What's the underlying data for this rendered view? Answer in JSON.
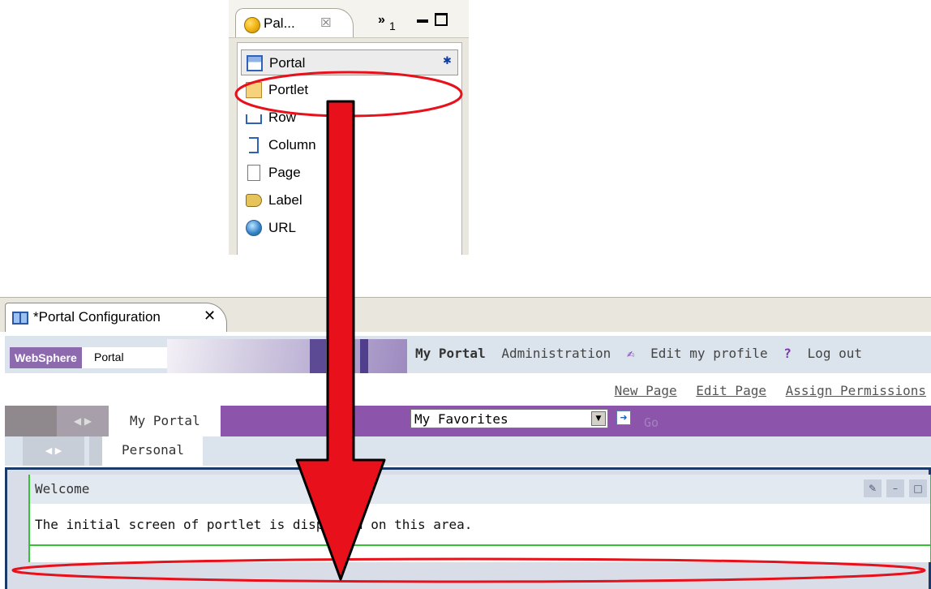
{
  "palette": {
    "tab_title": "Pal...",
    "tab_close": "☒",
    "overflow_count": "1",
    "items": [
      {
        "label": "Portal"
      },
      {
        "label": "Portlet"
      },
      {
        "label": "Row"
      },
      {
        "label": "Column"
      },
      {
        "label": "Page"
      },
      {
        "label": "Label"
      },
      {
        "label": "URL"
      }
    ]
  },
  "editor": {
    "tab_title": "*Portal Configuration",
    "tab_close": "✕"
  },
  "portal": {
    "logo_brand": "WebSphere",
    "logo_text": "Portal",
    "header_links": {
      "my_portal": "My Portal",
      "administration": "Administration",
      "edit_profile": "Edit my profile",
      "log_out": "Log out"
    },
    "actions": {
      "new_page": "New Page",
      "edit_page": "Edit Page",
      "assign_permissions": "Assign Permissions"
    },
    "nav1": {
      "tab": "My Portal",
      "favorites_value": "My Favorites",
      "go_label": "Go"
    },
    "nav2": {
      "tab": "Personal"
    },
    "portlet": {
      "title": "Welcome",
      "body": "The initial screen of portlet is displayed on this area."
    }
  },
  "colors": {
    "annotation": "#e8101a",
    "portal_purple": "#8c54aa",
    "portal_navy": "#1a3a68",
    "portlet_border": "#35c235"
  }
}
